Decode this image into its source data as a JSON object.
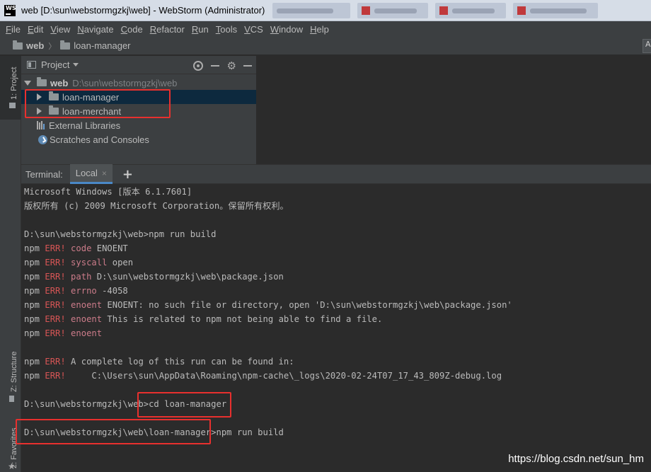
{
  "window": {
    "title": "web [D:\\sun\\webstormgzkj\\web] - WebStorm (Administrator)",
    "logo_text": "WS"
  },
  "menu": [
    "File",
    "Edit",
    "View",
    "Navigate",
    "Code",
    "Refactor",
    "Run",
    "Tools",
    "VCS",
    "Window",
    "Help"
  ],
  "breadcrumb": {
    "root": "web",
    "child": "loan-manager",
    "right_button": "A"
  },
  "left_strip": {
    "project_tab": "1: Project",
    "structure_tab": "Z: Structure",
    "favorites_tab": "2: Favorites"
  },
  "project_panel": {
    "header": "Project",
    "root_name": "web",
    "root_path": "D:\\sun\\webstormgzkj\\web",
    "items": [
      {
        "label": "loan-manager",
        "selected": true
      },
      {
        "label": "loan-merchant",
        "selected": false
      }
    ],
    "external_libraries": "External Libraries",
    "scratches": "Scratches and Consoles"
  },
  "terminal": {
    "title": "Terminal:",
    "tab_label": "Local",
    "close_glyph": "×",
    "add_glyph": "+",
    "lines": [
      {
        "text": "Microsoft Windows [版本 6.1.7601]"
      },
      {
        "text": "版权所有 (c) 2009 Microsoft Corporation。保留所有权利。"
      },
      {
        "text": ""
      },
      {
        "text": "D:\\sun\\webstormgzkj\\web>npm run build"
      },
      {
        "prefix": "npm ",
        "err": "ERR!",
        "key": " code",
        "rest": " ENOENT"
      },
      {
        "prefix": "npm ",
        "err": "ERR!",
        "key": " syscall",
        "rest": " open"
      },
      {
        "prefix": "npm ",
        "err": "ERR!",
        "key": " path",
        "rest": " D:\\sun\\webstormgzkj\\web\\package.json"
      },
      {
        "prefix": "npm ",
        "err": "ERR!",
        "key": " errno",
        "rest": " -4058"
      },
      {
        "prefix": "npm ",
        "err": "ERR!",
        "key": " enoent",
        "rest": " ENOENT: no such file or directory, open 'D:\\sun\\webstormgzkj\\web\\package.json'"
      },
      {
        "prefix": "npm ",
        "err": "ERR!",
        "key": " enoent",
        "rest": " This is related to npm not being able to find a file."
      },
      {
        "prefix": "npm ",
        "err": "ERR!",
        "key": " enoent",
        "rest": ""
      },
      {
        "text": ""
      },
      {
        "prefix": "npm ",
        "err": "ERR!",
        "key": "",
        "rest": " A complete log of this run can be found in:"
      },
      {
        "prefix": "npm ",
        "err": "ERR!",
        "key": "",
        "rest": "     C:\\Users\\sun\\AppData\\Roaming\\npm-cache\\_logs\\2020-02-24T07_17_43_809Z-debug.log"
      },
      {
        "text": ""
      },
      {
        "text": "D:\\sun\\webstormgzkj\\web>cd loan-manager"
      },
      {
        "text": ""
      },
      {
        "text": "D:\\sun\\webstormgzkj\\web\\loan-manager>npm run build"
      }
    ]
  },
  "watermark": "https://blog.csdn.net/sun_hm",
  "colors": {
    "annotation_red": "#e8302e",
    "err_red": "#d75555",
    "selection": "#0d293e",
    "accent_blue": "#4a88c7"
  }
}
